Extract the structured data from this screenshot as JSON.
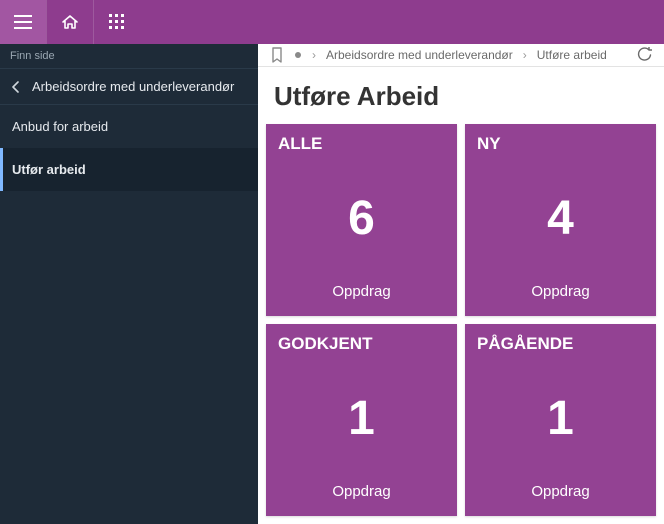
{
  "sidebar": {
    "find_page": "Finn side",
    "header": "Arbeidsordre med underleverandør",
    "items": [
      {
        "label": "Anbud for arbeid",
        "active": false
      },
      {
        "label": "Utfør arbeid",
        "active": true
      }
    ]
  },
  "breadcrumb": {
    "items": [
      "Arbeidsordre med underleverandør",
      "Utføre arbeid"
    ]
  },
  "page": {
    "title": "Utføre Arbeid"
  },
  "tiles": [
    {
      "title": "ALLE",
      "value": "6",
      "sub": "Oppdrag"
    },
    {
      "title": "NY",
      "value": "4",
      "sub": "Oppdrag"
    },
    {
      "title": "GODKJENT",
      "value": "1",
      "sub": "Oppdrag"
    },
    {
      "title": "PÅGÅENDE",
      "value": "1",
      "sub": "Oppdrag"
    }
  ]
}
